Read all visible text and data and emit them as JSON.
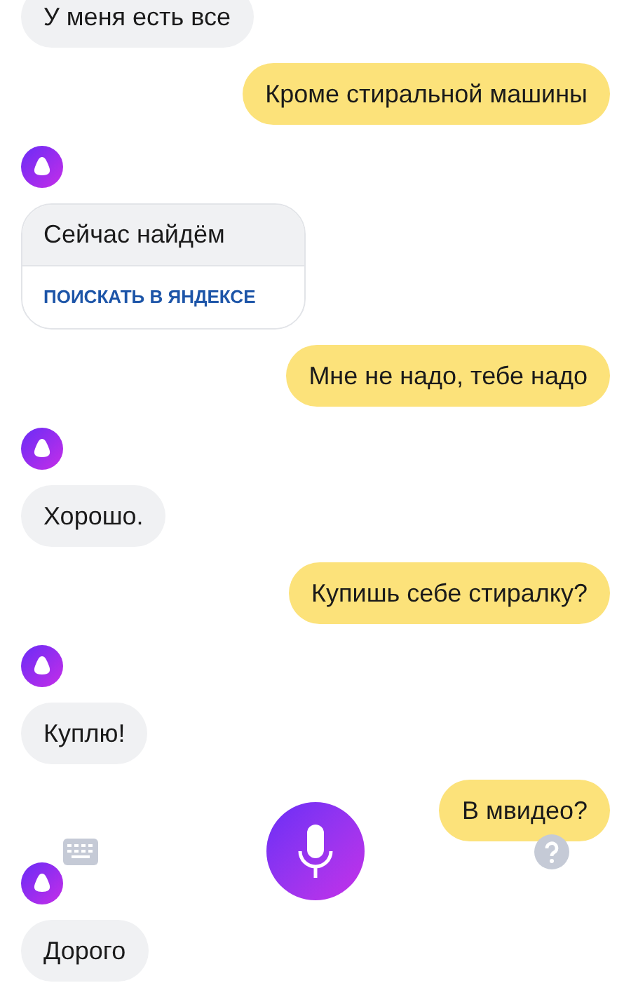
{
  "messages": [
    {
      "kind": "alice_bubble",
      "text": "У меня есть все"
    },
    {
      "kind": "user_bubble",
      "text": "Кроме стиральной машины"
    },
    {
      "kind": "avatar"
    },
    {
      "kind": "alice_card",
      "text": "Сейчас найдём",
      "button": "ПОИСКАТЬ В ЯНДЕКСЕ"
    },
    {
      "kind": "user_bubble",
      "text": "Мне не надо, тебе надо"
    },
    {
      "kind": "avatar"
    },
    {
      "kind": "alice_bubble",
      "text": "Хорошо."
    },
    {
      "kind": "user_bubble",
      "text": "Купишь себе стиралку?"
    },
    {
      "kind": "avatar"
    },
    {
      "kind": "alice_bubble",
      "text": "Куплю!"
    },
    {
      "kind": "user_bubble",
      "text": "В мвидео?"
    },
    {
      "kind": "avatar"
    },
    {
      "kind": "alice_bubble",
      "text": "Дорого"
    }
  ]
}
